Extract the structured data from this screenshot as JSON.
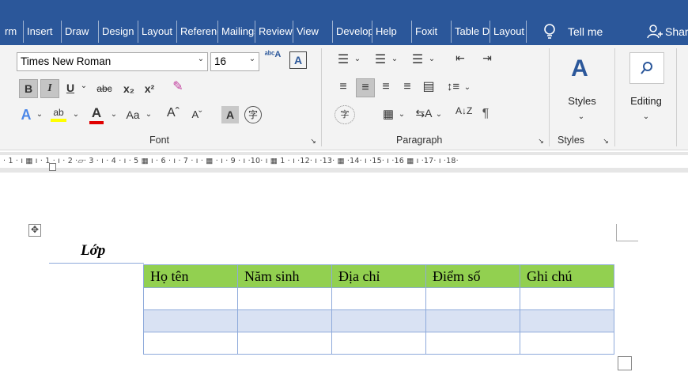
{
  "tabs": [
    {
      "label": "rm"
    },
    {
      "label": "Insert"
    },
    {
      "label": "Draw"
    },
    {
      "label": "Design"
    },
    {
      "label": "Layout"
    },
    {
      "label": "References"
    },
    {
      "label": "Mailings"
    },
    {
      "label": "Review"
    },
    {
      "label": "View"
    },
    {
      "label": "Developer"
    },
    {
      "label": "Help"
    },
    {
      "label": "Foxit"
    },
    {
      "label": "Table Design"
    },
    {
      "label": "Layout"
    }
  ],
  "tell_me": "Tell me",
  "share": "Share",
  "font": {
    "name": "Times New Roman",
    "size": "16",
    "group_label": "Font",
    "aa_label": "Aa"
  },
  "paragraph": {
    "group_label": "Paragraph"
  },
  "styles": {
    "button_label": "Styles",
    "group_label": "Styles"
  },
  "editing": {
    "button_label": "Editing"
  },
  "ruler": {
    "text": "· 1 · ı ▦ ı · 1 · ı · 2 ·▱· 3 · ı · 4 · ı · 5 ▦ ı · 6 · ı · 7 · ı · ▦ · ı · 9 · ı ·10· ı ▦ 1 · ı ·12· ı ·13· ▦ ·14· ı ·15· ı ·16 ▦ ı ·17· ı ·18·"
  },
  "document": {
    "class_label": "Lớp",
    "table": {
      "headers": [
        "Họ tên",
        "Năm sinh",
        "Địa chỉ",
        "Điểm số",
        "Ghi chú"
      ],
      "rows": [
        [
          "",
          "",
          "",
          "",
          ""
        ],
        [
          "",
          "",
          "",
          "",
          ""
        ],
        [
          "",
          "",
          "",
          "",
          ""
        ]
      ]
    }
  },
  "colors": {
    "tab_bar": "#2b579a",
    "header_row": "#92d050",
    "band_row": "#d9e2f3",
    "table_border": "#8eaadb"
  }
}
